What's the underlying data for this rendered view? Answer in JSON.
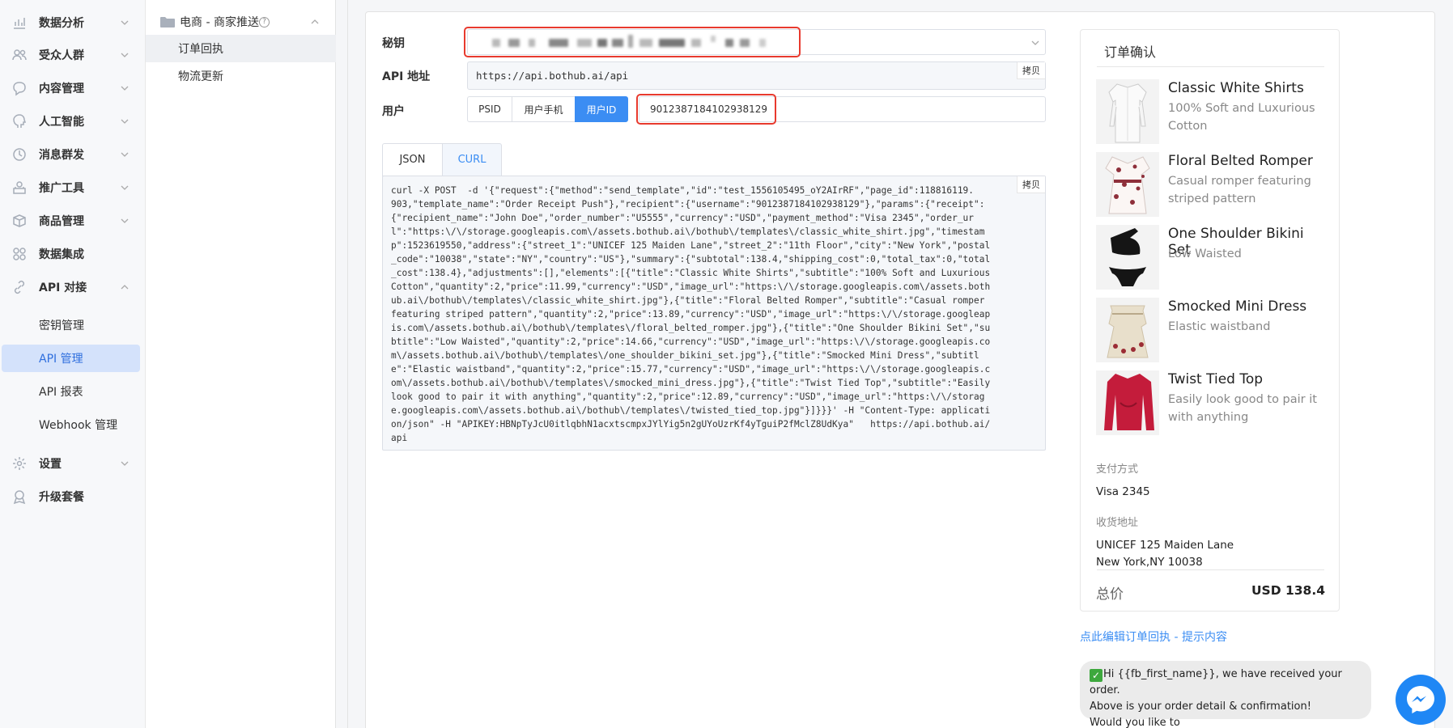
{
  "nav": {
    "items": [
      {
        "label": "数据分析",
        "icon": "analytics-icon"
      },
      {
        "label": "受众人群",
        "icon": "users-icon"
      },
      {
        "label": "内容管理",
        "icon": "chat-icon"
      },
      {
        "label": "人工智能",
        "icon": "brain-icon"
      },
      {
        "label": "消息群发",
        "icon": "broadcast-icon"
      },
      {
        "label": "推广工具",
        "icon": "promote-icon"
      },
      {
        "label": "商品管理",
        "icon": "product-icon"
      },
      {
        "label": "数据集成",
        "icon": "integration-icon"
      },
      {
        "label": "API 对接",
        "icon": "api-icon"
      }
    ],
    "api_sub": [
      "密钥管理",
      "API 管理",
      "API 报表",
      "Webhook 管理"
    ],
    "bottom": [
      {
        "label": "设置",
        "icon": "gear-icon"
      },
      {
        "label": "升级套餐",
        "icon": "upgrade-icon"
      }
    ]
  },
  "tree": {
    "group": "电商 - 商家推送",
    "items": [
      "订单回执",
      "物流更新"
    ]
  },
  "form": {
    "secret_label": "秘钥",
    "api_label": "API 地址",
    "api_url": "https://api.bothub.ai/api",
    "copy": "拷贝",
    "user_label": "用户",
    "user_tabs": [
      "PSID",
      "用户手机",
      "用户ID"
    ],
    "user_id": "9012387184102938129"
  },
  "tabs": [
    "JSON",
    "CURL"
  ],
  "curl_lines": [
    "curl -X POST  -d '{\"request\":{\"method\":\"send_template\",\"id\":\"test_1556105495_oY2AIrRF\",\"page_id\":118816119.",
    "903,\"template_name\":\"Order Receipt Push\"},\"recipient\":{\"username\":\"9012387184102938129\"},\"params\":{\"receipt\":",
    "{\"recipient_name\":\"John Doe\",\"order_number\":\"U5555\",\"currency\":\"USD\",\"payment_method\":\"Visa 2345\",\"order_ur",
    "l\":\"https:\\/\\/storage.googleapis.com\\/assets.bothub.ai\\/bothub\\/templates\\/classic_white_shirt.jpg\",\"timestam",
    "p\":1523619550,\"address\":{\"street_1\":\"UNICEF 125 Maiden Lane\",\"street_2\":\"11th Floor\",\"city\":\"New York\",\"postal",
    "_code\":\"10038\",\"state\":\"NY\",\"country\":\"US\"},\"summary\":{\"subtotal\":138.4,\"shipping_cost\":0,\"total_tax\":0,\"total",
    "_cost\":138.4},\"adjustments\":[],\"elements\":[{\"title\":\"Classic White Shirts\",\"subtitle\":\"100% Soft and Luxurious",
    "Cotton\",\"quantity\":2,\"price\":11.99,\"currency\":\"USD\",\"image_url\":\"https:\\/\\/storage.googleapis.com\\/assets.both",
    "ub.ai\\/bothub\\/templates\\/classic_white_shirt.jpg\"},{\"title\":\"Floral Belted Romper\",\"subtitle\":\"Casual romper",
    "featuring striped pattern\",\"quantity\":2,\"price\":13.89,\"currency\":\"USD\",\"image_url\":\"https:\\/\\/storage.googleap",
    "is.com\\/assets.bothub.ai\\/bothub\\/templates\\/floral_belted_romper.jpg\"},{\"title\":\"One Shoulder Bikini Set\",\"su",
    "btitle\":\"Low Waisted\",\"quantity\":2,\"price\":14.66,\"currency\":\"USD\",\"image_url\":\"https:\\/\\/storage.googleapis.co",
    "m\\/assets.bothub.ai\\/bothub\\/templates\\/one_shoulder_bikini_set.jpg\"},{\"title\":\"Smocked Mini Dress\",\"subtitl",
    "e\":\"Elastic waistband\",\"quantity\":2,\"price\":15.77,\"currency\":\"USD\",\"image_url\":\"https:\\/\\/storage.googleapis.c",
    "om\\/assets.bothub.ai\\/bothub\\/templates\\/smocked_mini_dress.jpg\"},{\"title\":\"Twist Tied Top\",\"subtitle\":\"Easily",
    "look good to pair it with anything\",\"quantity\":2,\"price\":12.89,\"currency\":\"USD\",\"image_url\":\"https:\\/\\/storag",
    "e.googleapis.com\\/assets.bothub.ai\\/bothub\\/templates\\/twisted_tied_top.jpg\"}]}}}' -H \"Content-Type: applicati",
    "on/json\" -H \"APIKEY:HBNpTyJcU0itlqbhN1acxtscmpxJYlYig5n2gUYoUzrKf4yTguiP2fMclZ8UdKya\"   https://api.bothub.ai/",
    "api"
  ],
  "preview": {
    "title": "订单确认",
    "items": [
      {
        "name": "Classic White Shirts",
        "sub": "100% Soft and Luxurious Cotton"
      },
      {
        "name": "Floral Belted Romper",
        "sub": "Casual romper featuring striped pattern"
      },
      {
        "name": "One Shoulder Bikini Set",
        "sub": "Low Waisted"
      },
      {
        "name": "Smocked Mini Dress",
        "sub": "Elastic waistband"
      },
      {
        "name": "Twist Tied Top",
        "sub": "Easily look good to pair it with anything"
      }
    ],
    "payment_label": "支付方式",
    "payment": "Visa 2345",
    "address_label": "收货地址",
    "address1": "UNICEF 125 Maiden Lane",
    "address2": "New York,NY 10038",
    "total_label": "总价",
    "total": "USD 138.4"
  },
  "edit_link": "点此编辑订单回执 - 提示内容",
  "bubble": {
    "line1": "Hi {{fb_first_name}}, we have received your order.",
    "line2": "Above is your order detail & confirmation!",
    "line3": "Would you like to"
  },
  "colors": {
    "accent": "#3b8df3",
    "highlight": "#e83a2e",
    "messenger": "#1f87f5"
  }
}
